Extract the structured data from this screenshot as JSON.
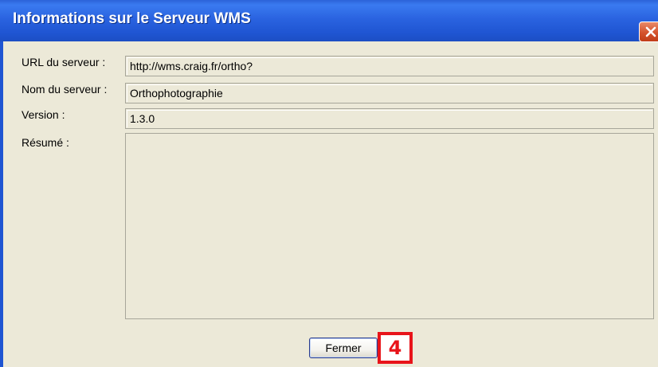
{
  "window": {
    "title": "Informations sur le Serveur WMS"
  },
  "fields": {
    "url_label": "URL du serveur :",
    "url_value": "http://wms.craig.fr/ortho?",
    "name_label": "Nom du serveur :",
    "name_value": "Orthophotographie",
    "version_label": "Version :",
    "version_value": "1.3.0",
    "summary_label": "Résumé :",
    "summary_value": ""
  },
  "buttons": {
    "close_label": "Fermer"
  },
  "annotation": {
    "callout_number": "4",
    "callout_color": "#e8141a"
  },
  "icons": {
    "close": "close-icon"
  }
}
